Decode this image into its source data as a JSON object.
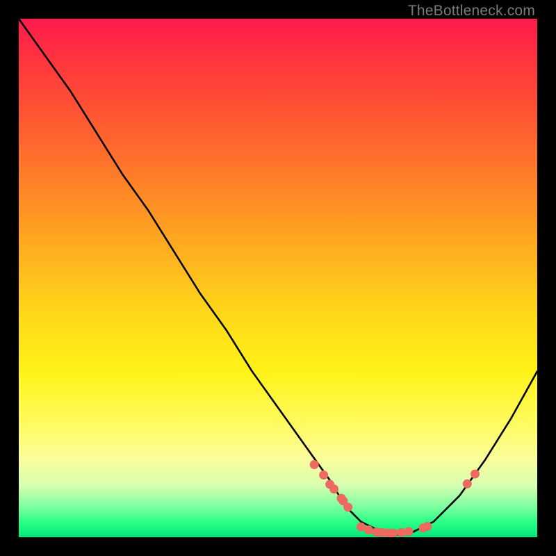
{
  "attribution": "TheBottleneck.com",
  "chart_data": {
    "type": "line",
    "title": "",
    "xlabel": "",
    "ylabel": "",
    "xlim": [
      0,
      100
    ],
    "ylim": [
      0,
      100
    ],
    "series": [
      {
        "name": "bottleneck-curve",
        "x": [
          0,
          5,
          10,
          15,
          20,
          25,
          30,
          35,
          40,
          45,
          50,
          55,
          60,
          63,
          66,
          70,
          73,
          76,
          80,
          85,
          90,
          95,
          100
        ],
        "y": [
          100,
          93,
          86,
          78,
          70,
          63,
          55,
          47,
          40,
          32,
          25,
          18,
          11,
          6,
          3,
          1,
          0.5,
          1,
          3,
          8,
          15,
          23,
          32
        ]
      }
    ],
    "markers": [
      {
        "x": 57.0,
        "y": 14.0
      },
      {
        "x": 58.8,
        "y": 12.0
      },
      {
        "x": 60.0,
        "y": 10.2
      },
      {
        "x": 60.8,
        "y": 9.3
      },
      {
        "x": 62.2,
        "y": 7.5
      },
      {
        "x": 62.6,
        "y": 7.0
      },
      {
        "x": 63.5,
        "y": 5.8
      },
      {
        "x": 66.0,
        "y": 2.0
      },
      {
        "x": 67.5,
        "y": 1.4
      },
      {
        "x": 69.0,
        "y": 1.0
      },
      {
        "x": 70.0,
        "y": 0.9
      },
      {
        "x": 71.2,
        "y": 0.8
      },
      {
        "x": 72.2,
        "y": 0.8
      },
      {
        "x": 73.8,
        "y": 0.9
      },
      {
        "x": 75.2,
        "y": 1.1
      },
      {
        "x": 78.0,
        "y": 1.8
      },
      {
        "x": 78.8,
        "y": 2.1
      },
      {
        "x": 86.5,
        "y": 10.3
      },
      {
        "x": 88.0,
        "y": 12.2
      }
    ],
    "marker_color": "#ec6a5f",
    "curve_color": "#000000"
  }
}
